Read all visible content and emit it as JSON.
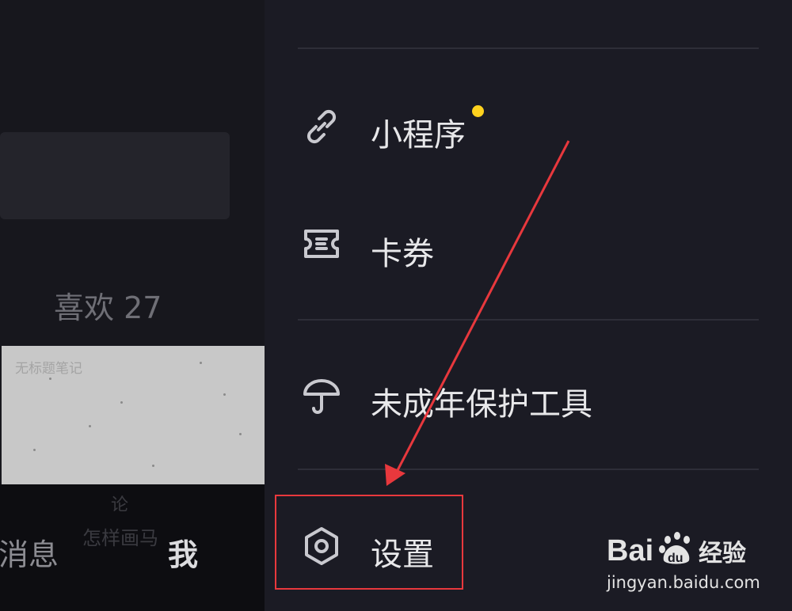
{
  "left_pane": {
    "likes_label": "喜欢 27",
    "thumbnail_title": "无标题笔记",
    "thumbnail_caption_top": "论",
    "thumbnail_caption": "怎样画马",
    "nav": {
      "messages_label": "消息",
      "me_label": "我"
    }
  },
  "drawer": {
    "items": [
      {
        "label": "小程序",
        "icon": "link-icon",
        "badge": "new-dot"
      },
      {
        "label": "卡券",
        "icon": "ticket-icon"
      },
      {
        "label": "未成年保护工具",
        "icon": "umbrella-icon"
      },
      {
        "label": "设置",
        "icon": "gear-icon"
      }
    ]
  },
  "annotation": {
    "highlight_color": "#e8383d",
    "target": "设置"
  },
  "watermark": {
    "brand": "Baidu经验",
    "url": "jingyan.baidu.com"
  },
  "colors": {
    "background": "#1b1b24",
    "badge": "#ffd21e",
    "text": "#e8e8ea"
  }
}
